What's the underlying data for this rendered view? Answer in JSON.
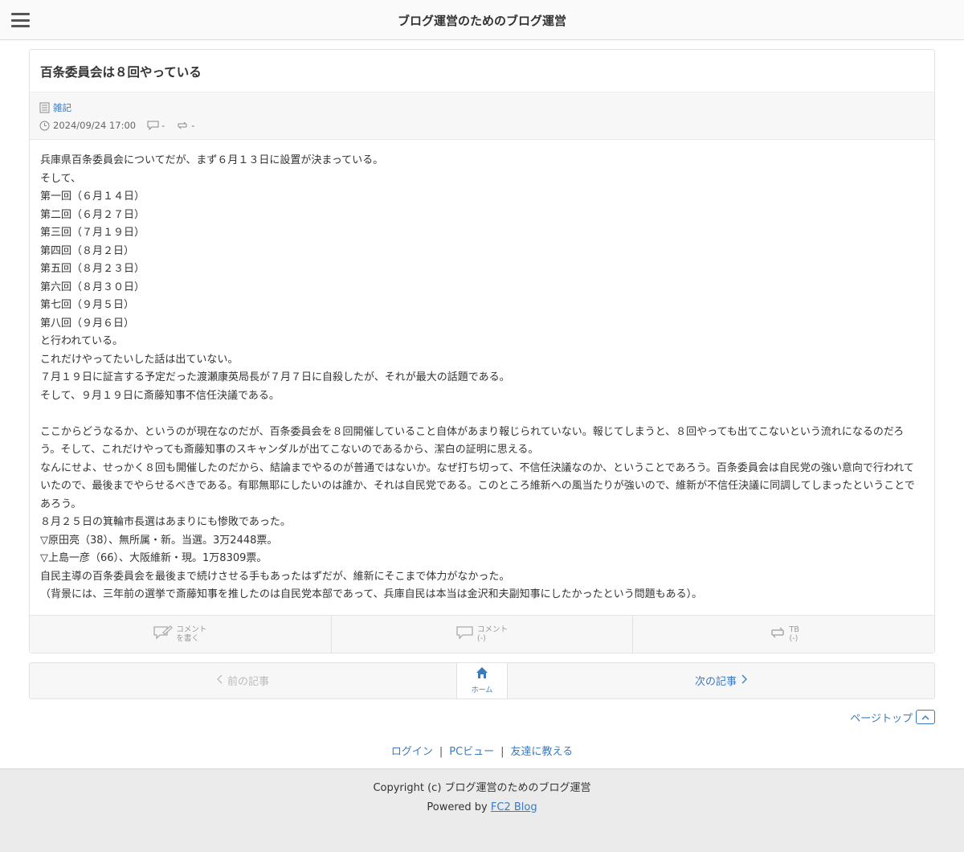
{
  "header": {
    "blog_title": "ブログ運営のためのブログ運営"
  },
  "article": {
    "title": "百条委員会は８回やっている",
    "category": "雑記",
    "datetime": "2024/09/24 17:00",
    "comment_count": "-",
    "trackback_count": "-",
    "body": [
      "兵庫県百条委員会についてだが、まず６月１３日に設置が決まっている。",
      "そして、",
      "第一回（６月１４日）",
      "第二回（６月２７日）",
      "第三回（７月１９日）",
      "第四回（８月２日）",
      "第五回（８月２３日）",
      "第六回（８月３０日）",
      "第七回（９月５日）",
      "第八回（９月６日）",
      "と行われている。",
      "これだけやってたいした話は出ていない。",
      "７月１９日に証言する予定だった渡瀬康英局長が７月７日に自殺したが、それが最大の話題である。",
      "そして、９月１９日に斎藤知事不信任決議である。",
      "",
      "ここからどうなるか、というのが現在なのだが、百条委員会を８回開催していること自体があまり報じられていない。報じてしまうと、８回やっても出てこないという流れになるのだろう。そして、これだけやっても斎藤知事のスキャンダルが出てこないのであるから、潔白の証明に思える。",
      "なんにせよ、せっかく８回も開催したのだから、結論までやるのが普通ではないか。なぜ打ち切って、不信任決議なのか、ということであろう。百条委員会は自民党の強い意向で行われていたので、最後までやらせるべきである。有耶無耶にしたいのは誰か、それは自民党である。このところ維新への風当たりが強いので、維新が不信任決議に同調してしまったということであろう。",
      "８月２５日の箕輪市長選はあまりにも惨敗であった。",
      "▽原田亮（38）、無所属・新。当選。3万2448票。",
      "▽上島一彦（66）、大阪維新・現。1万8309票。",
      "自民主導の百条委員会を最後まで続けさせる手もあったはずだが、維新にそこまで体力がなかった。",
      "（背景には、三年前の選挙で斎藤知事を推したのは自民党本部であって、兵庫自民は本当は金沢和夫副知事にしたかったという問題もある）。"
    ]
  },
  "actions": {
    "write_comment": {
      "line1": "コメント",
      "line2": "を書く"
    },
    "comments": {
      "line1": "コメント",
      "line2": "(-)"
    },
    "trackbacks": {
      "line1": "TB",
      "line2": "(-)"
    }
  },
  "pager": {
    "prev": "前の記事",
    "home": "ホーム",
    "next": "次の記事"
  },
  "pagetop": "ページトップ",
  "links": {
    "login": "ログイン",
    "pc_view": "PCビュー",
    "tell_friend": "友達に教える",
    "separator": "|"
  },
  "footer": {
    "copyright": "Copyright (c) ブログ運営のためのブログ運営",
    "powered_prefix": "Powered by",
    "powered_link": "FC2 Blog"
  },
  "colors": {
    "link": "#3a7bbf",
    "text": "#333333",
    "footer_bg": "#ebebeb"
  }
}
